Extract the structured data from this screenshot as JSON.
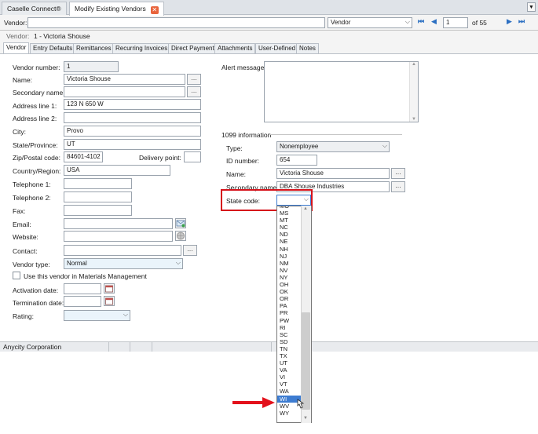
{
  "doc_tabs": [
    {
      "label": "Caselle Connect®"
    },
    {
      "label": "Modify Existing Vendors"
    }
  ],
  "toolbar": {
    "vendor_label": "Vendor:",
    "search_by": "Vendor",
    "page_value": "1",
    "page_of": "of 55"
  },
  "vendor_banner": {
    "label": "Vendor:",
    "value": "1 - Victoria Shouse"
  },
  "form_tabs": [
    "Vendor",
    "Entry Defaults",
    "Remittances",
    "Recurring Invoices",
    "Direct Payment",
    "Attachments",
    "User-Defined",
    "Notes"
  ],
  "vendor": {
    "vendor_number_label": "Vendor number:",
    "vendor_number": "1",
    "name_label": "Name:",
    "name": "Victoria Shouse",
    "secondary_name_label": "Secondary name:",
    "secondary_name": "",
    "address1_label": "Address line 1:",
    "address1": "123 N 650 W",
    "address2_label": "Address line 2:",
    "address2": "",
    "city_label": "City:",
    "city": "Provo",
    "state_label": "State/Province:",
    "state": "UT",
    "zip_label": "Zip/Postal code:",
    "zip": "84601-4102",
    "delivery_point_label": "Delivery point:",
    "delivery_point": "",
    "country_label": "Country/Region:",
    "country": "USA",
    "telephone1_label": "Telephone 1:",
    "telephone1": "",
    "telephone2_label": "Telephone 2:",
    "telephone2": "",
    "fax_label": "Fax:",
    "fax": "",
    "email_label": "Email:",
    "email": "",
    "website_label": "Website:",
    "website": "",
    "contact_label": "Contact:",
    "contact": "",
    "vendor_type_label": "Vendor type:",
    "vendor_type": "Normal",
    "materials_label": "Use this vendor in Materials Management",
    "activation_label": "Activation date:",
    "activation": "",
    "termination_label": "Termination date:",
    "termination": "",
    "rating_label": "Rating:",
    "rating": "",
    "alert_label": "Alert message:",
    "info1099_label": "1099 information",
    "type_label": "Type:",
    "type": "Nonemployee",
    "id_label": "ID number:",
    "id": "654",
    "name1099_label": "Name:",
    "name1099": "Victoria Shouse",
    "secondary1099_label": "Secondary name:",
    "secondary1099": "DBA Shouse Industries",
    "state_code_label": "State code:",
    "state_code": ""
  },
  "state_list": [
    "MO",
    "MS",
    "MT",
    "NC",
    "ND",
    "NE",
    "NH",
    "NJ",
    "NM",
    "NV",
    "NY",
    "OH",
    "OK",
    "OR",
    "PA",
    "PR",
    "PW",
    "RI",
    "SC",
    "SD",
    "TN",
    "TX",
    "UT",
    "VA",
    "VI",
    "VT",
    "WA",
    "WI",
    "WV",
    "WY"
  ],
  "state_list_selected": "WI",
  "status_bar": {
    "org": "Anycity Corporation"
  },
  "colors": {
    "highlight": "#d6121a",
    "arrow": "#e3111b",
    "selection": "#3d7cd1"
  }
}
